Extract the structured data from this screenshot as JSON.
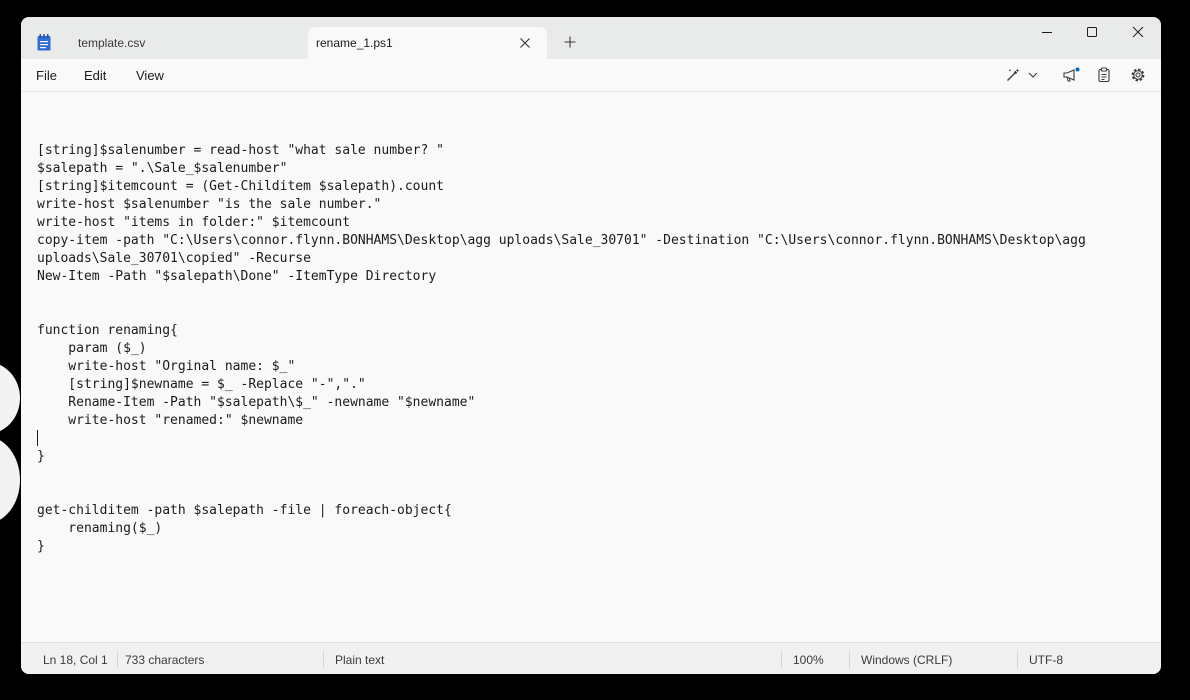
{
  "tabs": [
    {
      "label": "template.csv",
      "active": false
    },
    {
      "label": "rename_1.ps1",
      "active": true
    }
  ],
  "menu": {
    "file": "File",
    "edit": "Edit",
    "view": "View"
  },
  "editor": {
    "lines": [
      "[string]$salenumber = read-host \"what sale number? \"",
      "$salepath = \".\\Sale_$salenumber\"",
      "[string]$itemcount = (Get-Childitem $salepath).count",
      "write-host $salenumber \"is the sale number.\"",
      "write-host \"items in folder:\" $itemcount",
      "copy-item -path \"C:\\Users\\connor.flynn.BONHAMS\\Desktop\\agg uploads\\Sale_30701\" -Destination \"C:\\Users\\connor.flynn.BONHAMS\\Desktop\\agg",
      "uploads\\Sale_30701\\copied\" -Recurse",
      "New-Item -Path \"$salepath\\Done\" -ItemType Directory",
      "",
      "",
      "function renaming{",
      "    param ($_)",
      "    write-host \"Orginal name: $_\"",
      "    [string]$newname = $_ -Replace \"-\",\".\"",
      "    Rename-Item -Path \"$salepath\\$_\" -newname \"$newname\"",
      "    write-host \"renamed:\" $newname",
      "",
      "}",
      "",
      "",
      "get-childitem -path $salepath -file | foreach-object{",
      "    renaming($_)",
      "}"
    ]
  },
  "status": {
    "position": "Ln 18, Col 1",
    "characters": "733 characters",
    "format": "Plain text",
    "zoom": "100%",
    "line_ending": "Windows (CRLF)",
    "encoding": "UTF-8"
  },
  "colors": {
    "accent": "#0067c0",
    "icon_blue": "#2f6cd3"
  }
}
